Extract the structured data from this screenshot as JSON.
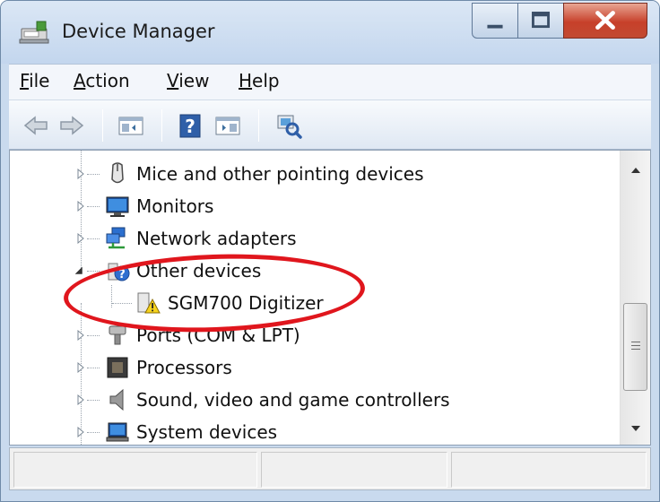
{
  "window": {
    "title": "Device Manager",
    "app_icon": "device-manager-icon"
  },
  "caption_buttons": [
    "minimize-icon",
    "maximize-icon",
    "close-icon"
  ],
  "menu": {
    "file": {
      "hotkey": "F",
      "rest": "ile"
    },
    "action": {
      "hotkey": "A",
      "rest": "ction"
    },
    "view": {
      "hotkey": "V",
      "rest": "iew"
    },
    "help": {
      "hotkey": "H",
      "rest": "elp"
    }
  },
  "toolbar": {
    "buttons": [
      "back-icon",
      "forward-icon",
      "show-hide-console-tree-icon",
      "help-icon",
      "show-hide-action-pane-icon",
      "scan-hardware-icon"
    ]
  },
  "tree": {
    "items": [
      {
        "label": "Mice and other pointing devices",
        "icon": "mouse-icon",
        "expanded": false
      },
      {
        "label": "Monitors",
        "icon": "monitor-icon",
        "expanded": false
      },
      {
        "label": "Network adapters",
        "icon": "network-adapter-icon",
        "expanded": false
      },
      {
        "label": "Other devices",
        "icon": "unknown-device-icon",
        "expanded": true
      },
      {
        "label": "SGM700 Digitizer",
        "icon": "warning-device-icon",
        "child": true
      },
      {
        "label": "Ports (COM & LPT)",
        "icon": "port-icon",
        "expanded": false
      },
      {
        "label": "Processors",
        "icon": "processor-icon",
        "expanded": false
      },
      {
        "label": "Sound, video and game controllers",
        "icon": "speaker-icon",
        "expanded": false
      },
      {
        "label": "System devices",
        "icon": "system-devices-icon",
        "expanded": false
      }
    ]
  },
  "annotation": {
    "color": "#e0161d",
    "target": "Other devices"
  },
  "colors": {
    "title_bg": "#c9daee",
    "close_button": "#c7402a",
    "highlight": "#e0161d"
  }
}
